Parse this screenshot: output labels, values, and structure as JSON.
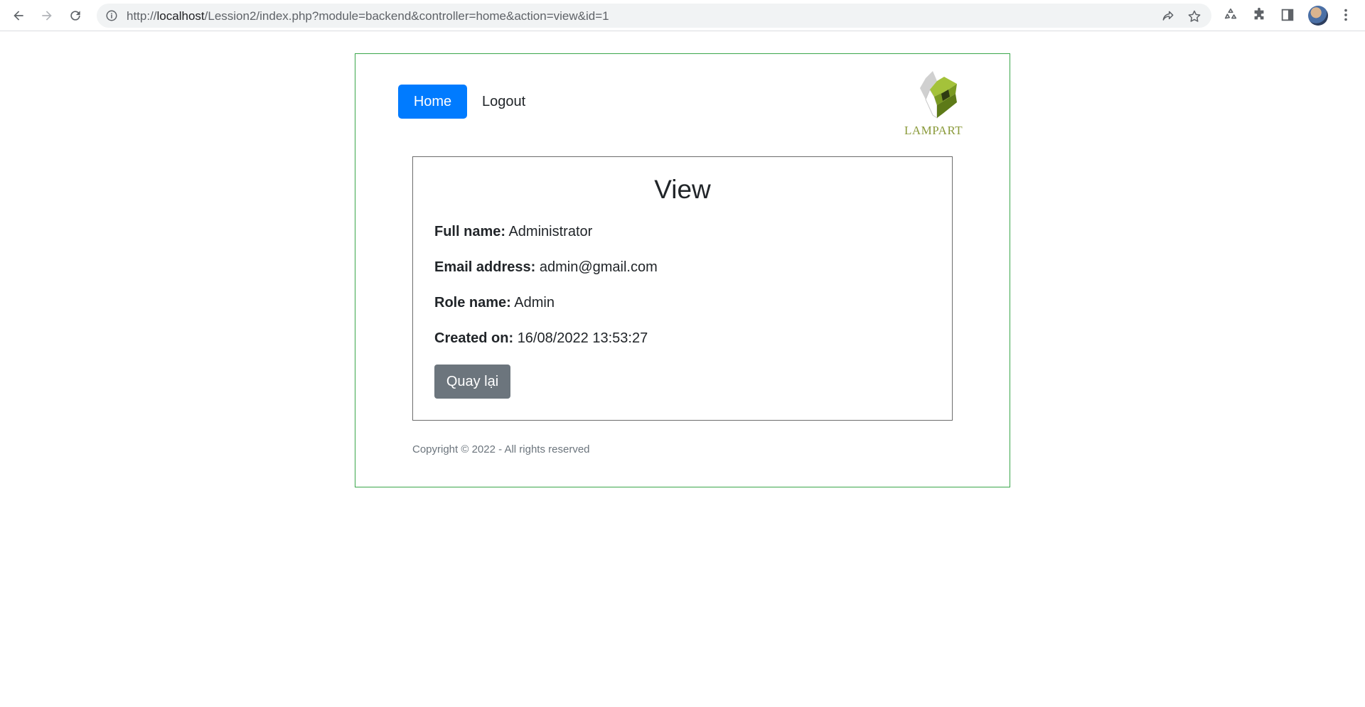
{
  "browser": {
    "url_prefix": "http://",
    "url_host": "localhost",
    "url_path": "/Lession2/index.php?module=backend&controller=home&action=view&id=1"
  },
  "nav": {
    "home_label": "Home",
    "logout_label": "Logout",
    "logo_text": "LAMPART"
  },
  "view": {
    "title": "View",
    "fields": [
      {
        "label": "Full name:",
        "value": "Administrator"
      },
      {
        "label": "Email address:",
        "value": "admin@gmail.com"
      },
      {
        "label": "Role name:",
        "value": "Admin"
      },
      {
        "label": "Created on:",
        "value": "16/08/2022 13:53:27"
      }
    ],
    "back_label": "Quay lại"
  },
  "footer": {
    "text": "Copyright © 2022 - All rights reserved"
  },
  "colors": {
    "primary": "#007bff",
    "secondary": "#6c757d",
    "frame_border": "#3aa64a",
    "logo_green": "#8a9a3a"
  },
  "icons": [
    "back-arrow-icon",
    "forward-arrow-icon",
    "reload-icon",
    "info-icon",
    "share-icon",
    "star-icon",
    "recycle-icon",
    "puzzle-icon",
    "side-panel-icon",
    "avatar",
    "more-vert-icon",
    "lampart-logo"
  ]
}
